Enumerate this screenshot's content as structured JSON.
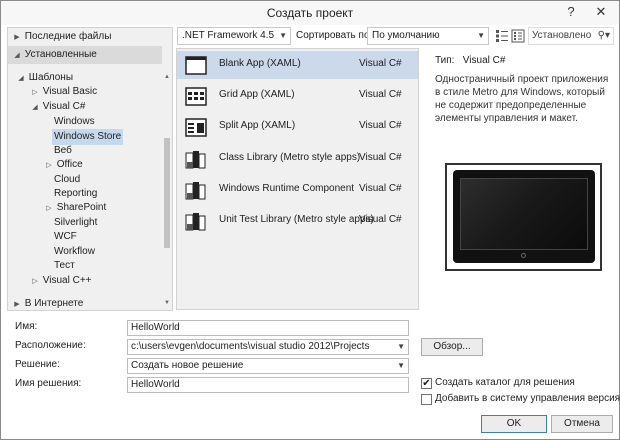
{
  "window": {
    "title": "Создать проект",
    "help_glyph": "?",
    "close_glyph": "✕"
  },
  "sidebar": {
    "recent": "Последние файлы",
    "installed": "Установленные",
    "templates": "Шаблоны",
    "items": [
      "Visual Basic",
      "Visual C#",
      "Windows",
      "Windows Store",
      "Веб",
      "Office",
      "Cloud",
      "Reporting",
      "SharePoint",
      "Silverlight",
      "WCF",
      "Workflow",
      "Тест",
      "Visual C++"
    ],
    "online": "В Интернете"
  },
  "toolbar": {
    "framework": ".NET Framework 4.5",
    "sort_label": "Сортировать по:",
    "sort_value": "По умолчанию",
    "search_text": "Установлено",
    "search_icon": "magnifier-icon"
  },
  "templates": [
    {
      "name": "Blank App (XAML)",
      "lang": "Visual C#"
    },
    {
      "name": "Grid App (XAML)",
      "lang": "Visual C#"
    },
    {
      "name": "Split App (XAML)",
      "lang": "Visual C#"
    },
    {
      "name": "Class Library (Metro style apps)",
      "lang": "Visual C#"
    },
    {
      "name": "Windows Runtime Component",
      "lang": "Visual C#"
    },
    {
      "name": "Unit Test Library (Metro style apps)",
      "lang": "Visual C#"
    }
  ],
  "details": {
    "type_label": "Тип:",
    "type_value": "Visual C#",
    "description": "Одностраничный проект приложения в стиле Metro для Windows, который не содержит предопределенные элементы управления и макет."
  },
  "form": {
    "name_label": "Имя:",
    "name_value": "HelloWorld",
    "location_label": "Расположение:",
    "location_value": "c:\\users\\evgen\\documents\\visual studio 2012\\Projects",
    "solution_label": "Решение:",
    "solution_value": "Создать новое решение",
    "solution_name_label": "Имя решения:",
    "solution_name_value": "HelloWorld",
    "browse": "Обзор...",
    "create_dir": "Создать каталог для решения",
    "create_dir_checked": "✔",
    "add_vcs": "Добавить в систему управления версиями",
    "ok": "OK",
    "cancel": "Отмена"
  }
}
